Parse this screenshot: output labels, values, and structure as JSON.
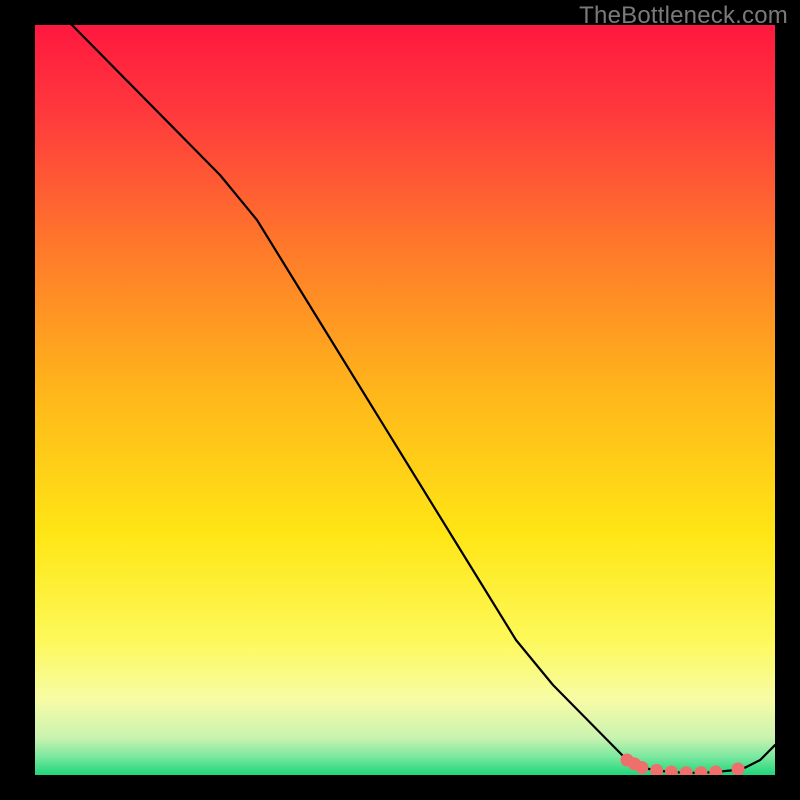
{
  "watermark": "TheBottleneck.com",
  "colors": {
    "page_bg": "#000000",
    "watermark": "#7a7a7a",
    "curve": "#000000",
    "markers": "#ef6f6c",
    "gradient_top": "#ff183f",
    "gradient_mid": "#ffd400",
    "gradient_green": "#1fd67a"
  },
  "chart_data": {
    "type": "line",
    "title": "",
    "xlabel": "",
    "ylabel": "",
    "xlim": [
      0,
      100
    ],
    "ylim": [
      0,
      100
    ],
    "series": [
      {
        "name": "bottleneck-curve",
        "x": [
          0,
          5,
          10,
          15,
          20,
          25,
          30,
          35,
          40,
          45,
          50,
          55,
          60,
          65,
          70,
          75,
          80,
          82,
          84,
          86,
          88,
          90,
          92,
          94,
          96,
          98,
          100
        ],
        "y": [
          105,
          100,
          95,
          90,
          85,
          80,
          74,
          66,
          58,
          50,
          42,
          34,
          26,
          18,
          12,
          7,
          2,
          1,
          0.6,
          0.4,
          0.3,
          0.3,
          0.4,
          0.6,
          1,
          2,
          4
        ]
      }
    ],
    "markers": {
      "name": "optimal-range",
      "points": [
        {
          "x": 80,
          "y": 2.0
        },
        {
          "x": 81,
          "y": 1.5
        },
        {
          "x": 82,
          "y": 1.0
        },
        {
          "x": 84,
          "y": 0.6
        },
        {
          "x": 86,
          "y": 0.4
        },
        {
          "x": 88,
          "y": 0.3
        },
        {
          "x": 90,
          "y": 0.3
        },
        {
          "x": 92,
          "y": 0.4
        },
        {
          "x": 95,
          "y": 0.8
        }
      ]
    },
    "background": {
      "type": "vertical-gradient",
      "stops": [
        {
          "pos": 0.0,
          "color": "#ff183f"
        },
        {
          "pos": 0.12,
          "color": "#ff3a3d"
        },
        {
          "pos": 0.3,
          "color": "#ff7a2a"
        },
        {
          "pos": 0.5,
          "color": "#ffb91a"
        },
        {
          "pos": 0.68,
          "color": "#ffe615"
        },
        {
          "pos": 0.82,
          "color": "#fdf95a"
        },
        {
          "pos": 0.9,
          "color": "#f7fca6"
        },
        {
          "pos": 0.95,
          "color": "#caf3b0"
        },
        {
          "pos": 0.975,
          "color": "#7de8a0"
        },
        {
          "pos": 1.0,
          "color": "#1fd67a"
        }
      ]
    }
  }
}
